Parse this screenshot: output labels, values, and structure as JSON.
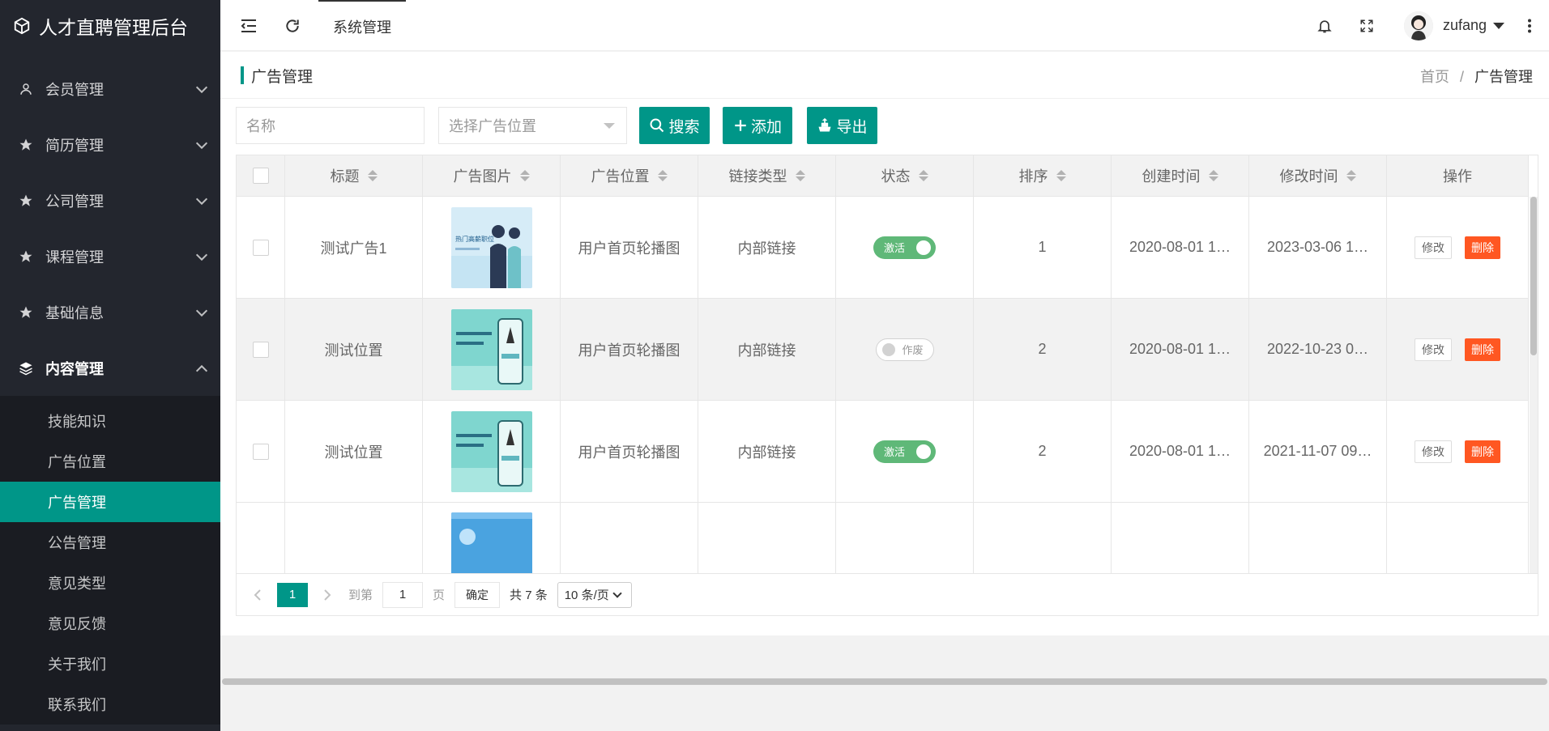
{
  "sidebar": {
    "title": "人才直聘管理后台",
    "menu": [
      {
        "label": "会员管理",
        "icon": "user-icon"
      },
      {
        "label": "简历管理",
        "icon": "star-icon"
      },
      {
        "label": "公司管理",
        "icon": "star-icon"
      },
      {
        "label": "课程管理",
        "icon": "star-icon"
      },
      {
        "label": "基础信息",
        "icon": "star-icon"
      },
      {
        "label": "内容管理",
        "icon": "layers-icon"
      }
    ],
    "submenu": [
      "技能知识",
      "广告位置",
      "广告管理",
      "公告管理",
      "意见类型",
      "意见反馈",
      "关于我们",
      "联系我们"
    ],
    "active_submenu": "广告管理"
  },
  "header": {
    "tab": "系统管理",
    "username": "zufang"
  },
  "page": {
    "title": "广告管理",
    "breadcrumb_home": "首页",
    "breadcrumb_sep": "/",
    "breadcrumb_current": "广告管理"
  },
  "toolbar": {
    "name_placeholder": "名称",
    "position_placeholder": "选择广告位置",
    "search_label": "搜索",
    "add_label": "添加",
    "export_label": "导出"
  },
  "table": {
    "headers": [
      "标题",
      "广告图片",
      "广告位置",
      "链接类型",
      "状态",
      "排序",
      "创建时间",
      "修改时间",
      "操作"
    ],
    "rows": [
      {
        "title": "测试广告1",
        "position": "用户首页轮播图",
        "link_type": "内部链接",
        "status": "激活",
        "status_on": true,
        "sort": "1",
        "created": "2020-08-01 1…",
        "modified": "2023-03-06 1…"
      },
      {
        "title": "测试位置",
        "position": "用户首页轮播图",
        "link_type": "内部链接",
        "status": "作废",
        "status_on": false,
        "sort": "2",
        "created": "2020-08-01 1…",
        "modified": "2022-10-23 0…"
      },
      {
        "title": "测试位置",
        "position": "用户首页轮播图",
        "link_type": "内部链接",
        "status": "激活",
        "status_on": true,
        "sort": "2",
        "created": "2020-08-01 1…",
        "modified": "2021-11-07 09…"
      }
    ],
    "edit_label": "修改",
    "delete_label": "删除",
    "img1_text": "热门高薪职位"
  },
  "pager": {
    "current": "1",
    "goto_label": "到第",
    "goto_value": "1",
    "page_unit": "页",
    "confirm_label": "确定",
    "total_label": "共 7 条",
    "page_size": "10 条/页"
  },
  "colors": {
    "accent": "#009688",
    "sidebar": "#23262e",
    "danger": "#ff5722",
    "switch_on": "#5fb878"
  }
}
